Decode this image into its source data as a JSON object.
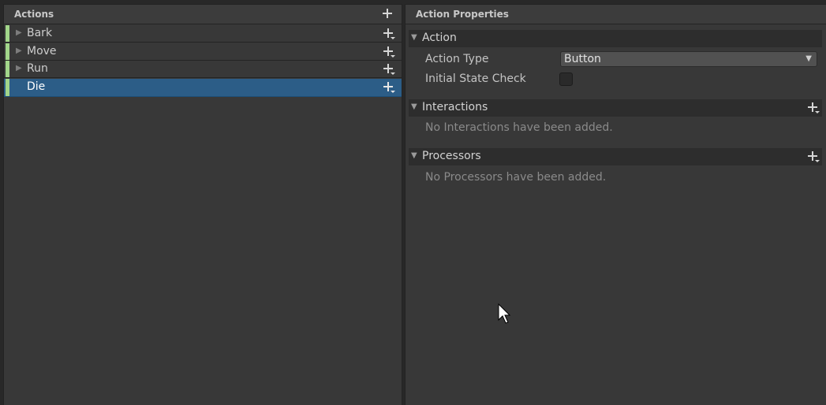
{
  "actions_panel": {
    "title": "Actions",
    "items": [
      {
        "label": "Bark",
        "expanded": false,
        "selected": false
      },
      {
        "label": "Move",
        "expanded": false,
        "selected": false
      },
      {
        "label": "Run",
        "expanded": false,
        "selected": false
      },
      {
        "label": "Die",
        "expanded": false,
        "selected": true
      }
    ],
    "stripe_color": "#a2d68a",
    "selection_color": "#2c5d87"
  },
  "properties_panel": {
    "title": "Action Properties",
    "action_section": {
      "label": "Action",
      "action_type_label": "Action Type",
      "action_type_value": "Button",
      "initial_state_check_label": "Initial State Check",
      "initial_state_check": false
    },
    "interactions_section": {
      "label": "Interactions",
      "empty_text": "No Interactions have been added."
    },
    "processors_section": {
      "label": "Processors",
      "empty_text": "No Processors have been added."
    }
  },
  "icons": {
    "expand": "triangle-right-icon",
    "collapse": "triangle-down-icon",
    "add": "plus-icon",
    "add_dropdown": "plus-dropdown-icon",
    "dropdown": "chevron-down-icon",
    "cursor": "mouse-pointer-icon"
  }
}
